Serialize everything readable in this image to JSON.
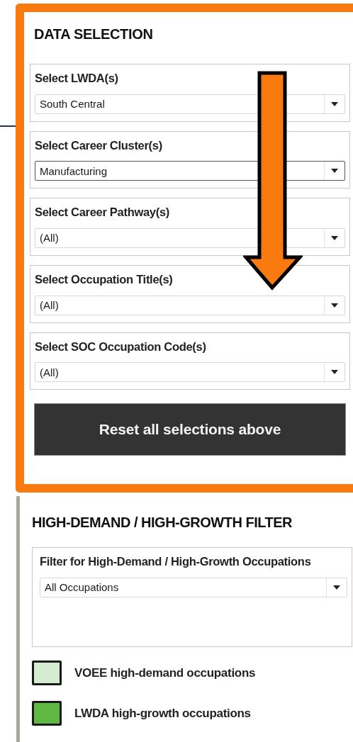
{
  "data_selection": {
    "title": "DATA SELECTION",
    "filters": [
      {
        "label": "Select LWDA(s)",
        "value": "South Central",
        "focused": false
      },
      {
        "label": "Select Career Cluster(s)",
        "value": "Manufacturing",
        "focused": true
      },
      {
        "label": "Select Career Pathway(s)",
        "value": "(All)",
        "focused": false
      },
      {
        "label": "Select Occupation Title(s)",
        "value": "(All)",
        "focused": false
      },
      {
        "label": "Select SOC Occupation Code(s)",
        "value": "(All)",
        "focused": false
      }
    ],
    "reset_button": "Reset all selections above"
  },
  "high_demand_filter": {
    "title": "HIGH-DEMAND / HIGH-GROWTH FILTER",
    "filter": {
      "label": "Filter for High-Demand / High-Growth Occupations",
      "value": "All Occupations",
      "focused": false
    },
    "legend": [
      {
        "label": "VOEE high-demand occupations",
        "color": "#d5ecd2"
      },
      {
        "label": "LWDA high-growth occupations",
        "color": "#5fb844"
      }
    ]
  }
}
